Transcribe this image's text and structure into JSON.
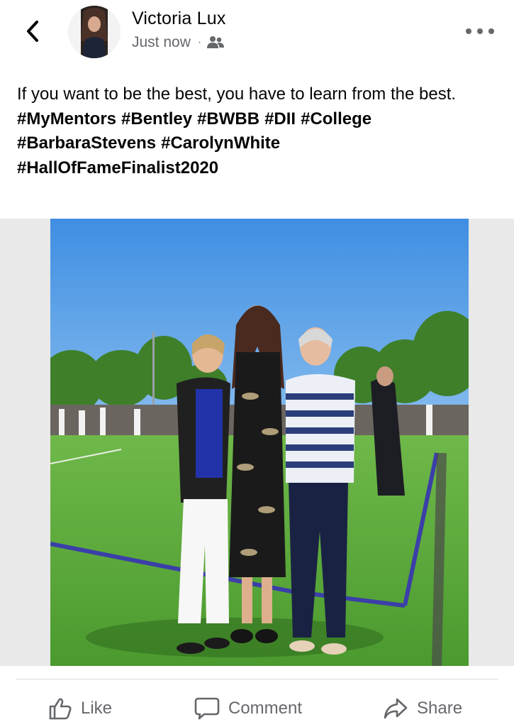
{
  "post": {
    "author": "Victoria Lux",
    "timestamp": "Just now",
    "separator": "·",
    "audience_icon": "friends-icon",
    "text": "If you want to be the best, you have to learn from the best.",
    "hashtags": [
      "#MyMentors",
      "#Bentley",
      "#BWBB",
      "#DII",
      "#College",
      "#BarbaraStevens",
      "#CarolynWhite",
      "#HallOfFameFinalist2020"
    ]
  },
  "actions": {
    "like": "Like",
    "comment": "Comment",
    "share": "Share"
  },
  "icons": {
    "back": "chevron-left-icon",
    "more": "more-horizontal-icon",
    "like": "thumbs-up-icon",
    "comment": "comment-bubble-icon",
    "share": "share-arrow-icon"
  },
  "colors": {
    "text_primary": "#050505",
    "text_secondary": "#65676b",
    "sky": "#4f9ae6",
    "grass": "#58a83a",
    "field_line": "#3b3fa8"
  }
}
